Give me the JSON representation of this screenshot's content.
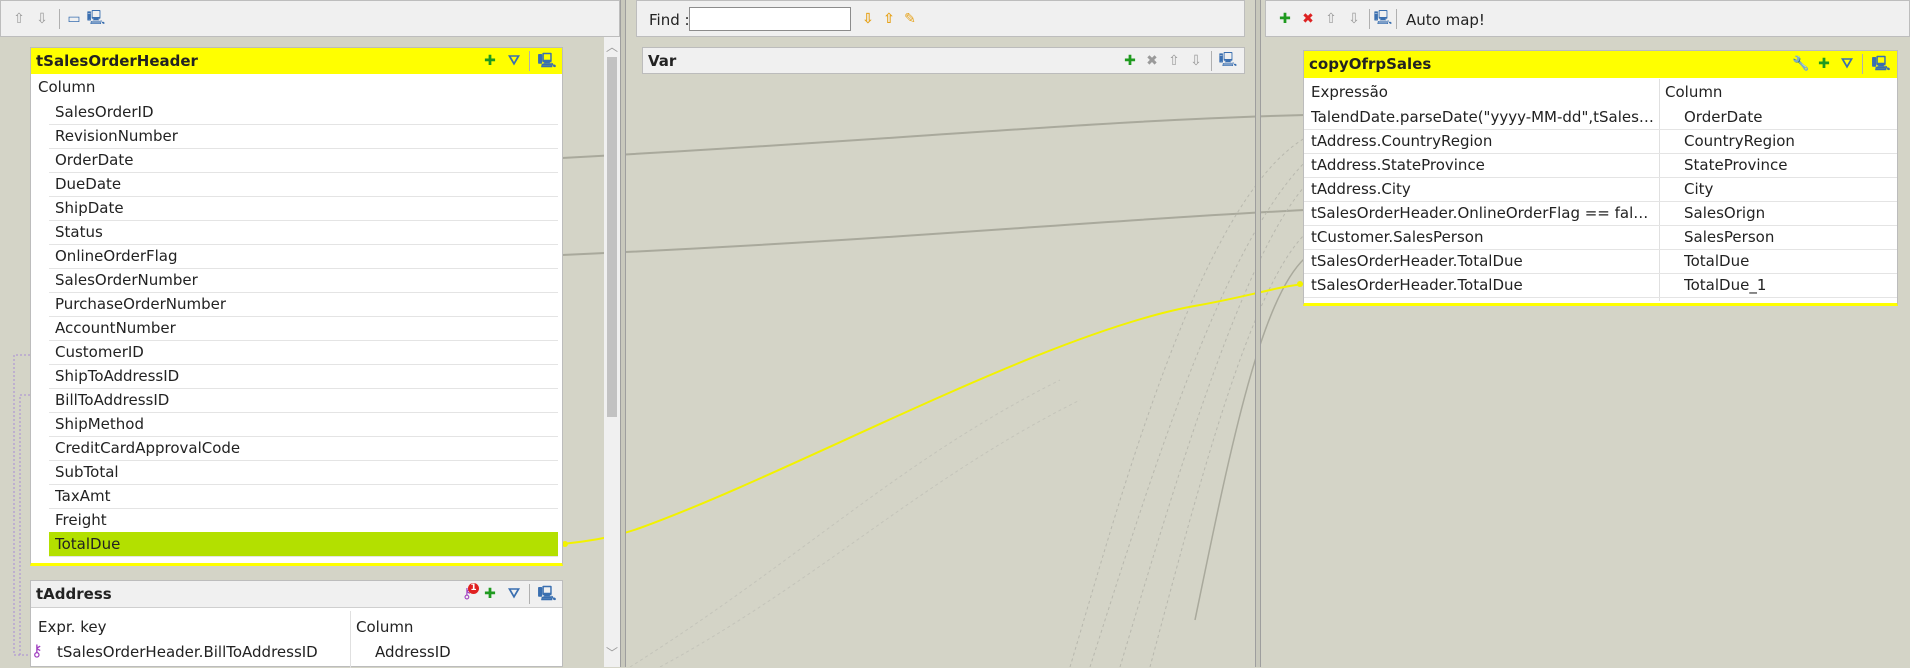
{
  "left_toolbar": {
    "icons": [
      "arrow-up-icon",
      "arrow-down-icon",
      "window-icon",
      "monitor-icon"
    ]
  },
  "center_toolbar": {
    "find_label": "Find :",
    "find_value": ""
  },
  "right_toolbar": {
    "auto_map_label": "Auto map!"
  },
  "sales_table": {
    "title": "tSalesOrderHeader",
    "column_header": "Column",
    "rows": [
      "SalesOrderID",
      "RevisionNumber",
      "OrderDate",
      "DueDate",
      "ShipDate",
      "Status",
      "OnlineOrderFlag",
      "SalesOrderNumber",
      "PurchaseOrderNumber",
      "AccountNumber",
      "CustomerID",
      "ShipToAddressID",
      "BillToAddressID",
      "ShipMethod",
      "CreditCardApprovalCode",
      "SubTotal",
      "TaxAmt",
      "Freight",
      "TotalDue"
    ],
    "selected": "TotalDue"
  },
  "address_table": {
    "title": "tAddress",
    "badge": "1",
    "headers": {
      "expr": "Expr. key",
      "column": "Column"
    },
    "rows": [
      {
        "expr": "tSalesOrderHeader.BillToAddressID",
        "column": "AddressID"
      }
    ]
  },
  "var_table": {
    "title": "Var"
  },
  "output_table": {
    "title": "copyOfrpSales",
    "headers": {
      "expr": "Expressão",
      "column": "Column"
    },
    "rows": [
      {
        "expr": "TalendDate.parseDate(\"yyyy-MM-dd\",tSalesOrder...",
        "column": "OrderDate"
      },
      {
        "expr": "tAddress.CountryRegion",
        "column": "CountryRegion"
      },
      {
        "expr": "tAddress.StateProvince",
        "column": "StateProvince"
      },
      {
        "expr": "tAddress.City",
        "column": "City"
      },
      {
        "expr": "tSalesOrderHeader.OnlineOrderFlag == false ? \"V...",
        "column": "SalesOrign"
      },
      {
        "expr": "tCustomer.SalesPerson",
        "column": "SalesPerson"
      },
      {
        "expr": "tSalesOrderHeader.TotalDue",
        "column": "TotalDue"
      },
      {
        "expr": "tSalesOrderHeader.TotalDue",
        "column": "TotalDue_1"
      }
    ]
  },
  "colors": {
    "highlight": "#ffff00",
    "selected_row": "#b3e000",
    "background": "#d4d4c7"
  }
}
